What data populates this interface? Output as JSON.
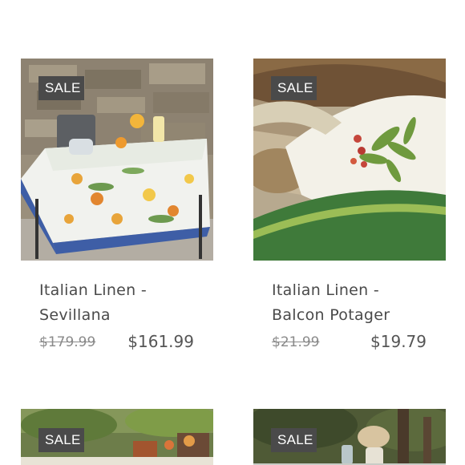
{
  "products": [
    {
      "badge": "SALE",
      "title_line1": "Italian Linen -",
      "title_line2": "Sevillana",
      "old_price": "$179.99",
      "new_price": "$161.99"
    },
    {
      "badge": "SALE",
      "title_line1": "Italian Linen -",
      "title_line2": "Balcon Potager",
      "old_price": "$21.99",
      "new_price": "$19.79"
    },
    {
      "badge": "SALE"
    },
    {
      "badge": "SALE"
    }
  ]
}
